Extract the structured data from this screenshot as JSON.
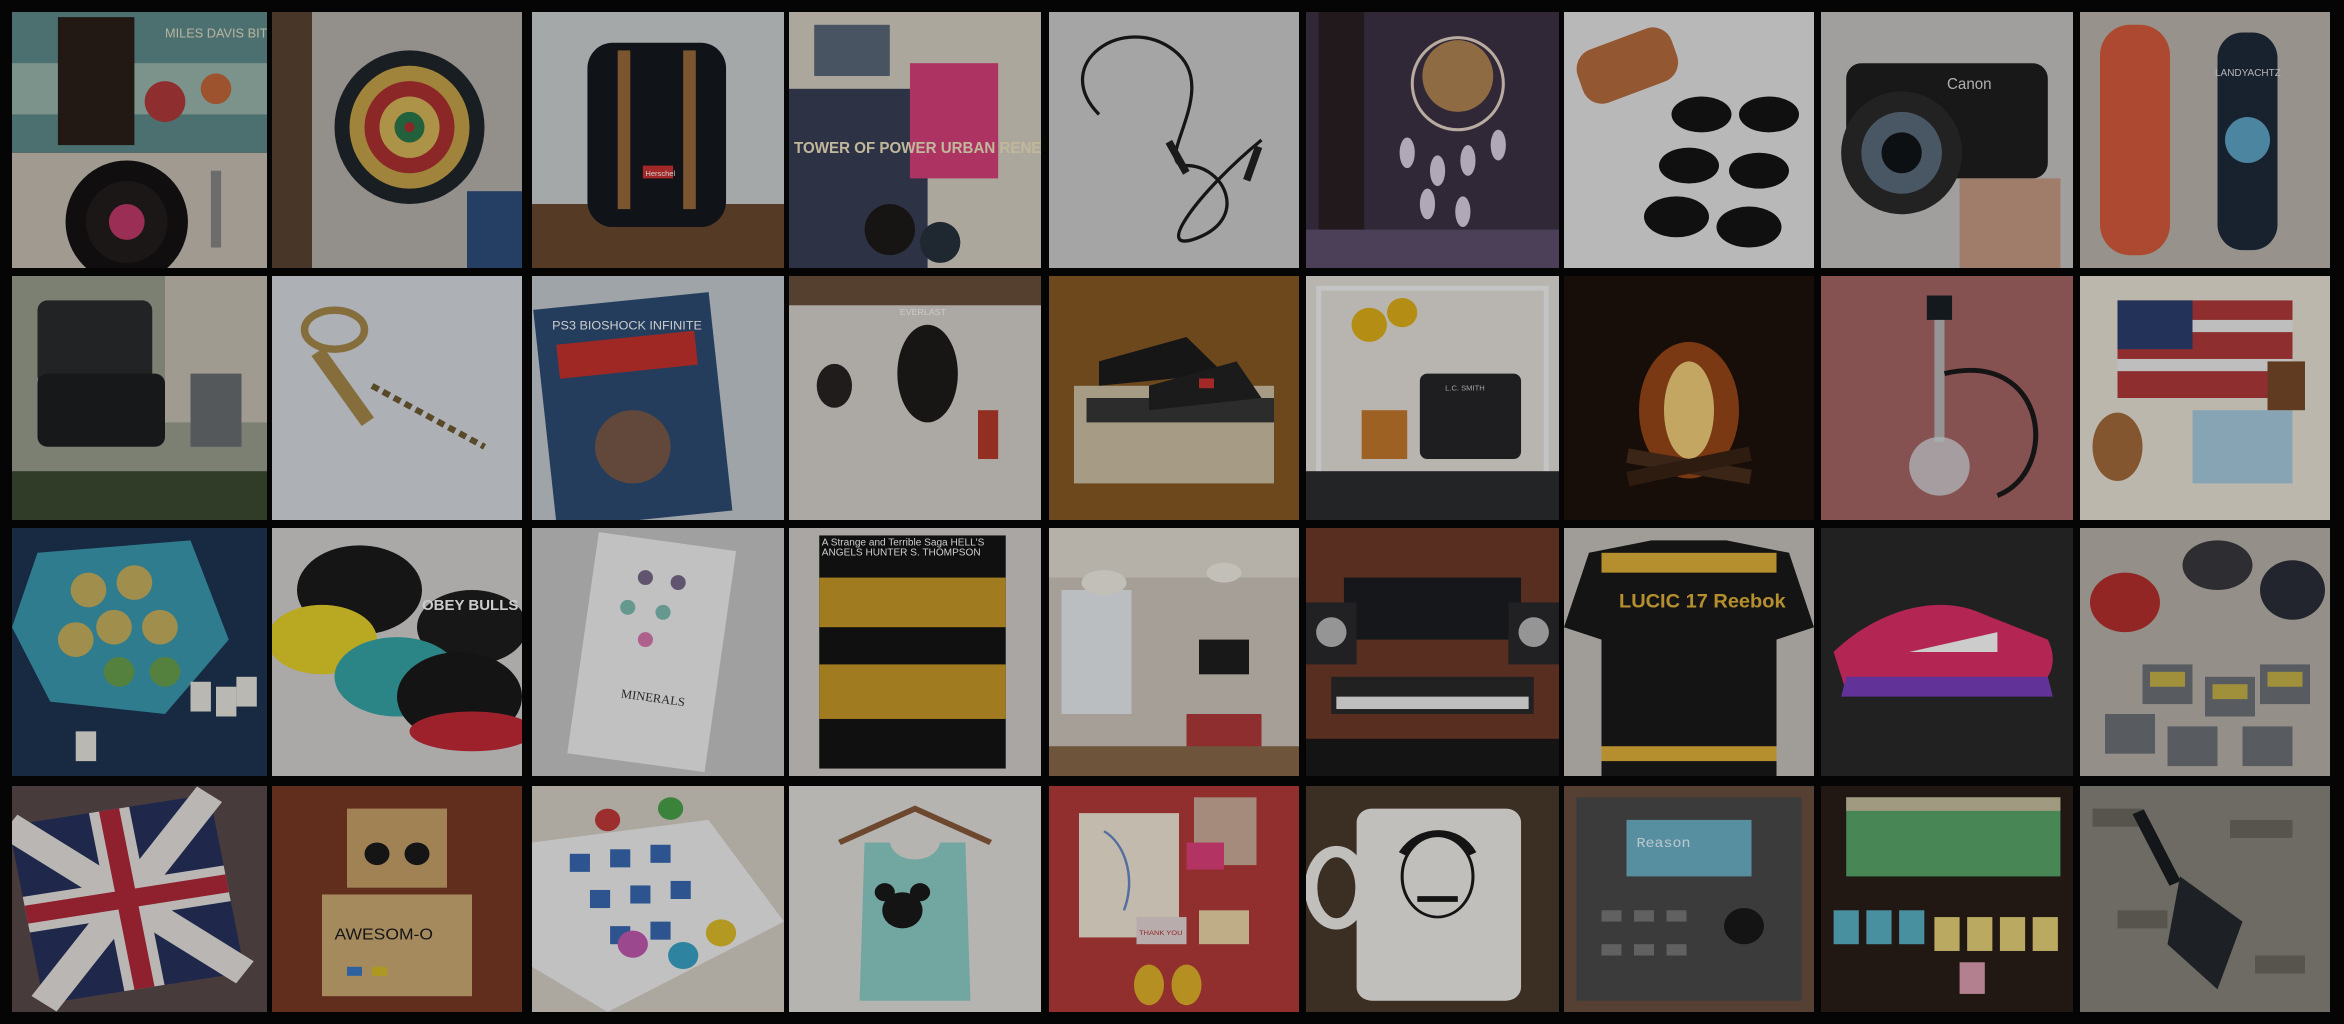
{
  "photos": {
    "r0": [
      {
        "subject": "vinyl record and turntable",
        "text": "MILES DAVIS BITCHES BREW"
      },
      {
        "subject": "dartboard"
      },
      {
        "subject": "black backpack",
        "text": "Herschel"
      },
      {
        "subject": "stack of records",
        "text": "TOWER OF POWER URBAN RENEWAL"
      },
      {
        "subject": "jump rope"
      },
      {
        "subject": "dreamcatcher"
      },
      {
        "subject": "sunglasses and case"
      },
      {
        "subject": "camera",
        "text": "Canon"
      },
      {
        "subject": "skateboards",
        "text": "LANDYACHTZ"
      }
    ],
    "r1": [
      {
        "subject": "smoker grill"
      },
      {
        "subject": "corkscrew"
      },
      {
        "subject": "video game case",
        "text": "PS3 BIOSHOCK INFINITE"
      },
      {
        "subject": "punching bag",
        "text": "EVERLAST"
      },
      {
        "subject": "sneakers on records"
      },
      {
        "subject": "sunflowers and typewriter",
        "text": "L.C. SMITH"
      },
      {
        "subject": "campfire"
      },
      {
        "subject": "hookah"
      },
      {
        "subject": "flag sweater and shorts"
      }
    ],
    "r2": [
      {
        "subject": "board game"
      },
      {
        "subject": "snapback hats",
        "text": "OBEY BULLS I ♥ Haters!"
      },
      {
        "subject": "notebook",
        "text": "MINERALS"
      },
      {
        "subject": "book",
        "text": "A Strange and Terrible Saga HELL'S ANGELS HUNTER S. THOMPSON"
      },
      {
        "subject": "loft interior"
      },
      {
        "subject": "music studio"
      },
      {
        "subject": "hockey jersey",
        "text": "LUCIC 17 Reebok"
      },
      {
        "subject": "sneaker"
      },
      {
        "subject": "controllers and cartridges"
      }
    ],
    "r3": [
      {
        "subject": "union jack pillow"
      },
      {
        "subject": "cardboard costume",
        "text": "AWESOM-O"
      },
      {
        "subject": "chess set"
      },
      {
        "subject": "tank top on hanger"
      },
      {
        "subject": "map and stationery",
        "text": "THANK YOU"
      },
      {
        "subject": "mug"
      },
      {
        "subject": "synthesizer",
        "text": "Reason"
      },
      {
        "subject": "board game"
      },
      {
        "subject": "shovel"
      }
    ]
  }
}
